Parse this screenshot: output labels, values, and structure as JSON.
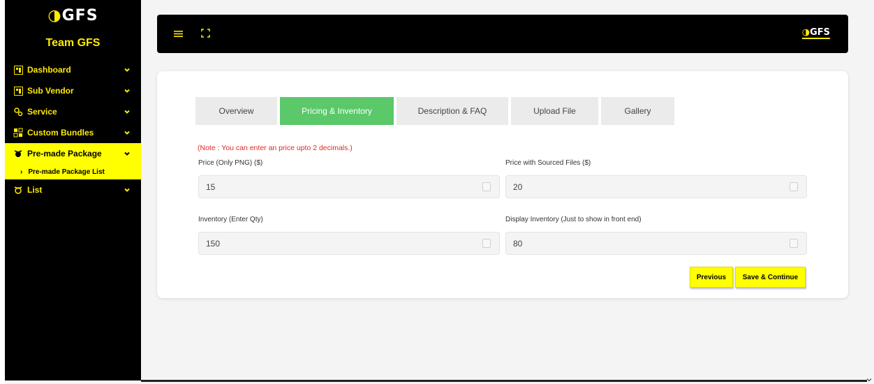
{
  "brand": {
    "logo_text": "GFS",
    "logo_tagline": "GRAPHICS FOR STREAMERS",
    "team_name": "Team GFS",
    "accent": "#ffea00"
  },
  "sidebar": {
    "items": [
      {
        "label": "Dashboard",
        "icon": "dashboard-icon"
      },
      {
        "label": "Sub Vendor",
        "icon": "vendor-icon"
      },
      {
        "label": "Service",
        "icon": "service-icon"
      },
      {
        "label": "Custom Bundles",
        "icon": "bundles-icon"
      },
      {
        "label": "Pre-made Package",
        "icon": "package-icon",
        "active": true
      },
      {
        "label": "List",
        "icon": "list-icon"
      }
    ],
    "sub_items": [
      {
        "label": "Pre-made Package List"
      }
    ]
  },
  "topbar": {
    "brand_text": "GFS"
  },
  "tabs": [
    {
      "label": "Overview"
    },
    {
      "label": "Pricing & Inventory",
      "active": true
    },
    {
      "label": "Description & FAQ"
    },
    {
      "label": "Upload File"
    },
    {
      "label": "Gallery"
    }
  ],
  "form": {
    "note": "(Note : You can enter an price upto 2 decimals.)",
    "price_png": {
      "label": "Price (Only PNG) ($)",
      "value": "15"
    },
    "price_sourced": {
      "label": "Price with Sourced Files ($)",
      "value": "20"
    },
    "inventory": {
      "label": "Inventory (Enter Qty)",
      "value": "150"
    },
    "display_inventory": {
      "label": "Display Inventory (Just to show in front end)",
      "value": "80"
    }
  },
  "buttons": {
    "previous": "Previous",
    "save_continue": "Save & Continue"
  },
  "colors": {
    "active_tab": "#5bc86a",
    "note": "#e32626",
    "button": "#ffff00"
  }
}
